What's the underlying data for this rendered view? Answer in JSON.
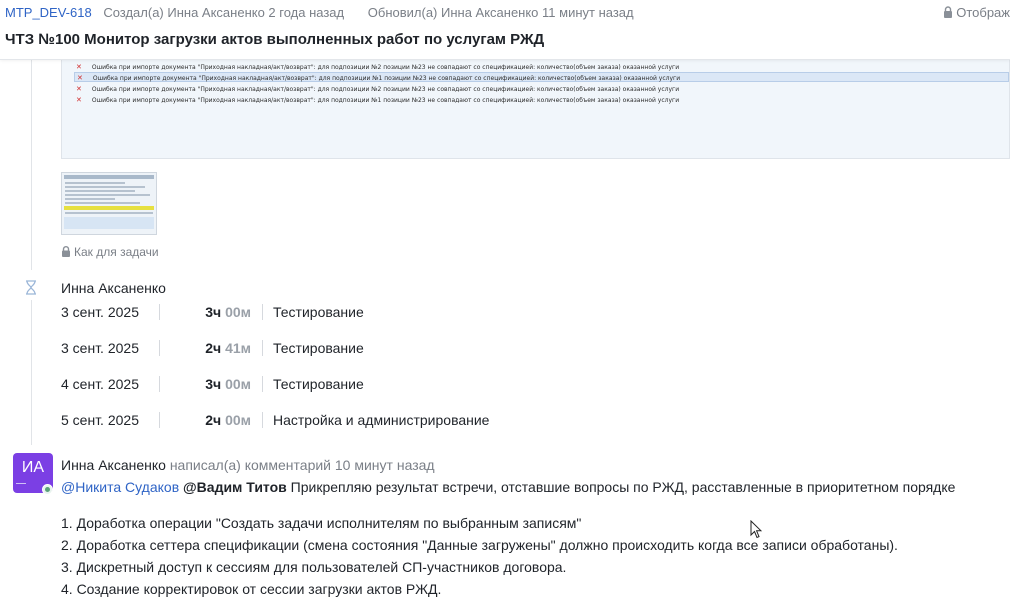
{
  "header": {
    "issue_key": "MTP_DEV-618",
    "created": "Создал(а) Инна Аксаненко 2 года назад",
    "updated": "Обновил(а) Инна Аксаненко 11 минут назад",
    "visibility": "Отображ",
    "title": "ЧТЗ №100 Монитор загрузки актов выполненных работ по услугам РЖД"
  },
  "attachment": {
    "error_rows": [
      "Ошибка при импорте документа \"Приходная накладная/акт/возврат\": для подпозиции №2 позиции №23  не совпадают со спецификацией: количество(объем заказа) оказанной услуги",
      "Ошибка при импорте документа \"Приходная накладная/акт/возврат\": для подпозиции №1 позиции №23  не совпадают со спецификацией: количество(объем заказа) оказанной услуги",
      "Ошибка при импорте документа \"Приходная накладная/акт/возврат\": для подпозиции №2 позиции №23  не совпадают со спецификацией: количество(объем заказа) оказанной услуги",
      "Ошибка при импорте документа \"Приходная накладная/акт/возврат\": для подпозиции №1 позиции №23  не совпадают со спецификацией: количество(объем заказа) оказанной услуги"
    ],
    "restriction_label": "Как для задачи"
  },
  "worklog": {
    "author": "Инна Аксаненко",
    "entries": [
      {
        "date": "3 сент. 2025",
        "hours": "3ч",
        "minutes": "00м",
        "activity": "Тестирование"
      },
      {
        "date": "3 сент. 2025",
        "hours": "2ч",
        "minutes": "41м",
        "activity": "Тестирование"
      },
      {
        "date": "4 сент. 2025",
        "hours": "3ч",
        "minutes": "00м",
        "activity": "Тестирование"
      },
      {
        "date": "5 сент. 2025",
        "hours": "2ч",
        "minutes": "00м",
        "activity": "Настройка и администрирование"
      }
    ]
  },
  "comment": {
    "avatar_initials": "ИА",
    "author": "Инна Аксаненко",
    "action": "написал(а) комментарий 10 минут назад",
    "mention_1": "@Никита Судаков",
    "mention_2": "@Вадим Титов",
    "text": "Прикрепляю результат встречи, отставшие вопросы по РЖД, расставленные в приоритетном порядке",
    "list": [
      "1. Доработка операции \"Создать задачи исполнителям по выбранным записям\"",
      "2. Доработка сеттера спецификации (смена состояния \"Данные загружены\" должно происходить когда все записи обработаны).",
      "3. Дискретный доступ к сессиям для пользователей СП-участников договора.",
      "4. Создание корректировок от сессии загрузки актов РЖД."
    ]
  },
  "colors": {
    "link": "#2f64c6",
    "avatar": "#7b3fe4",
    "error_mark": "#d02b2b"
  }
}
